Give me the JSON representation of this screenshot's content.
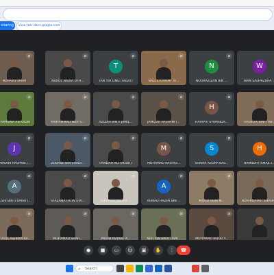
{
  "browser": {
    "share_button": "sharing",
    "site_tab": "View tab: docs.google.com"
  },
  "meet": {
    "tiles": [
      {
        "name": "NORAINI OMAR",
        "kind": "video",
        "bg": "#6e5c4e"
      },
      {
        "name": "NURUL NADIA OTH...",
        "kind": "video",
        "bg": "#4b4848"
      },
      {
        "name": "TAN YIH LING (AUDIT)",
        "kind": "avatar",
        "letter": "T",
        "color": "#0b8f7a"
      },
      {
        "name": "NAZLETCHUMY A/...",
        "kind": "video",
        "bg": "#8a6a4a"
      },
      {
        "name": "NOORAZIZAN BIN ...",
        "kind": "avatar",
        "letter": "N",
        "color": "#1e8e3e"
      },
      {
        "name": "WAN SALFAIZURA ...",
        "kind": "avatar",
        "letter": "W",
        "color": "#7b1fa2"
      },
      {
        "name": "SYAMSINA AB KADIR",
        "kind": "video",
        "bg": "#5d7a3c"
      },
      {
        "name": "MUHAMMAD NUR S...",
        "kind": "video",
        "bg": "#706b63"
      },
      {
        "name": "AZIZAH BINTI JAMIL...",
        "kind": "video",
        "bg": "#4a4a4a"
      },
      {
        "name": "JAMIZAR RASPANI (...",
        "kind": "video",
        "bg": "#5a5248"
      },
      {
        "name": "HARYATI SYAMSIDA...",
        "kind": "avatar",
        "letter": "H",
        "color": "#795548"
      },
      {
        "name": "HASIFZA BINTI AB...",
        "kind": "video",
        "bg": "#806a58"
      },
      {
        "name": "JAMSARI RASPANI (...",
        "kind": "avatar",
        "letter": "J",
        "color": "#5e35b1"
      },
      {
        "name": "ZUBAIDI BIN SHADI...",
        "kind": "video",
        "bg": "#4d5866"
      },
      {
        "name": "FARIDAH ALI (AUDIT)",
        "kind": "video",
        "bg": "#4a4a4a"
      },
      {
        "name": "MOHAMAD RASHID...",
        "kind": "avatar",
        "letter": "M",
        "color": "#795548"
      },
      {
        "name": "SHAIRA AZURA KAS...",
        "kind": "avatar",
        "letter": "S",
        "color": "#0288d1"
      },
      {
        "name": "HAMIDAH ISMAIL (...",
        "kind": "avatar",
        "letter": "H",
        "color": "#ef6c00"
      },
      {
        "name": "ALSHI BINTI OMAR (...",
        "kind": "avatar",
        "letter": "A",
        "color": "#546e7a"
      },
      {
        "name": "STAZANA FATIN SYA...",
        "kind": "video",
        "bg": "#4a4a4a"
      },
      {
        "name": "SHAHRUL NIZAM ...",
        "kind": "video",
        "bg": "#c9c4bc"
      },
      {
        "name": "AHMAD HAZIM BIN ...",
        "kind": "avatar",
        "letter": "A",
        "color": "#1565c0"
      },
      {
        "name": "MOHD HOW N...",
        "kind": "video",
        "bg": "#8d7b66"
      },
      {
        "name": "NORHIDAYATI SHAHR...",
        "kind": "video",
        "bg": "#7a6a5a"
      },
      {
        "name": "NURUL ASHIKIN KA...",
        "kind": "video",
        "bg": "#7b6a5a"
      },
      {
        "name": "MOHAMAD SHAH...",
        "kind": "video",
        "bg": "#5e5a55"
      },
      {
        "name": "MOHD ASYRAF A...",
        "kind": "video",
        "bg": "#6b6862"
      },
      {
        "name": "NUR AIN BINTI OSM...",
        "kind": "video",
        "bg": "#6a7055"
      },
      {
        "name": "MOHAMAD NOOR Y...",
        "kind": "video",
        "bg": "#5b4a40"
      },
      {
        "name": "",
        "kind": "video",
        "bg": "#3a3a3a"
      }
    ]
  },
  "controls": [
    {
      "icon": "mic-icon",
      "glyph": "●"
    },
    {
      "icon": "camera-icon",
      "glyph": "■"
    },
    {
      "icon": "captions-icon",
      "glyph": "▭"
    },
    {
      "icon": "emoji-icon",
      "glyph": "☺"
    },
    {
      "icon": "present-icon",
      "glyph": "▣"
    },
    {
      "icon": "raise-hand-icon",
      "glyph": "✋"
    },
    {
      "icon": "more-options-icon",
      "glyph": "⋮"
    },
    {
      "icon": "end-call-icon",
      "glyph": "☎"
    }
  ],
  "taskbar": {
    "search_label": "Search",
    "apps": [
      {
        "icon": "windows-start-icon",
        "color": "#1a73e8"
      },
      {
        "icon": "task-view-icon",
        "color": "#444444"
      },
      {
        "icon": "file-explorer-icon",
        "color": "#f4b400"
      },
      {
        "icon": "edge-icon",
        "color": "#0b8a5a"
      },
      {
        "icon": "store-icon",
        "color": "#3367d6"
      },
      {
        "icon": "mail-icon",
        "color": "#1565c0"
      },
      {
        "icon": "word-icon",
        "color": "#2b579a"
      },
      {
        "icon": "chrome-icon",
        "color": "#db4437"
      },
      {
        "icon": "settings-icon",
        "color": "#616161"
      }
    ]
  }
}
